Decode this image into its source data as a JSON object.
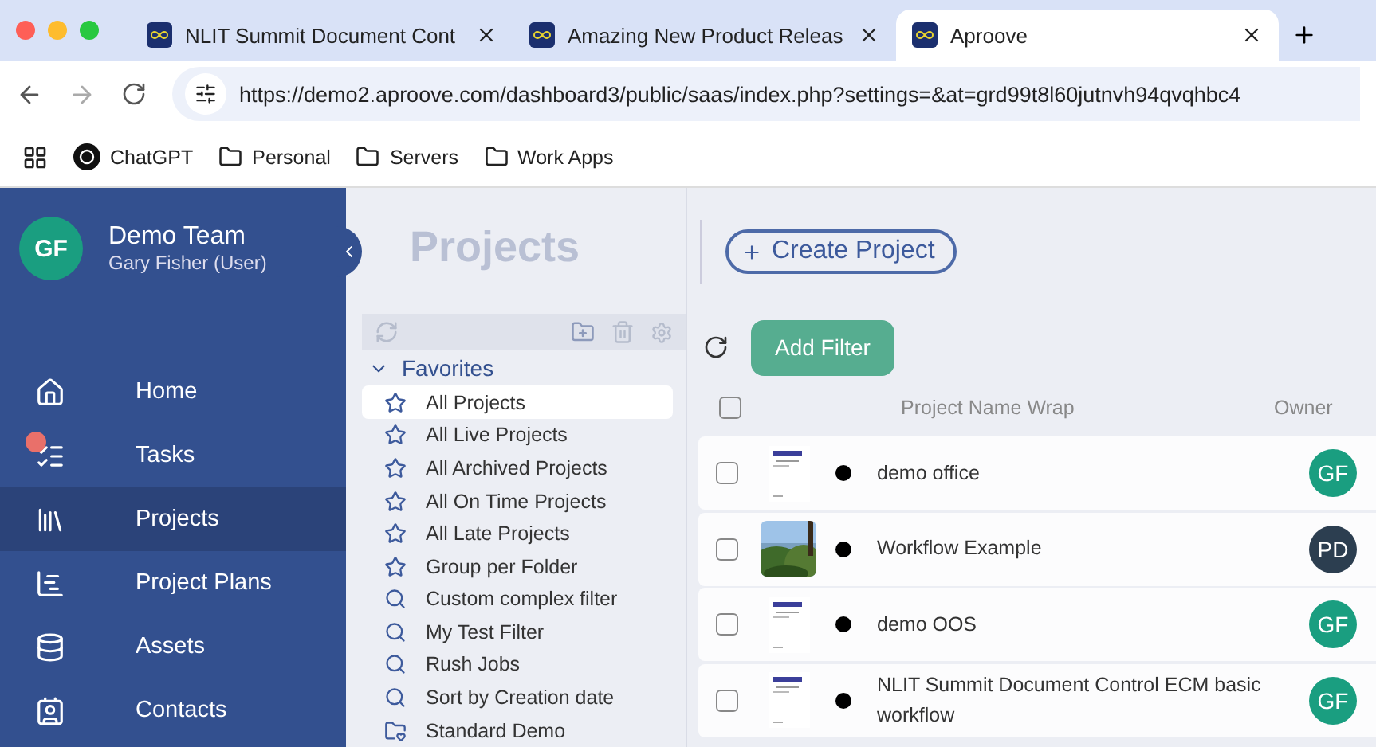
{
  "browser": {
    "tabs": [
      {
        "title": "NLIT Summit Document Cont",
        "selected": false
      },
      {
        "title": "Amazing New Product Releas",
        "selected": false
      },
      {
        "title": "Aproove",
        "selected": true
      }
    ],
    "url": "https://demo2.aproove.com/dashboard3/public/saas/index.php?settings=&at=grd99t8l60jutnvh94qvqhbc4",
    "bookmarks": [
      {
        "kind": "site",
        "label": "ChatGPT"
      },
      {
        "kind": "folder",
        "label": "Personal"
      },
      {
        "kind": "folder",
        "label": "Servers"
      },
      {
        "kind": "folder",
        "label": "Work Apps"
      }
    ]
  },
  "user": {
    "initials": "GF",
    "team": "Demo Team",
    "name": "Gary Fisher (User)"
  },
  "nav": [
    {
      "kind": "home",
      "label": "Home",
      "selected": false,
      "badge": false
    },
    {
      "kind": "tasks",
      "label": "Tasks",
      "selected": false,
      "badge": true
    },
    {
      "kind": "projects",
      "label": "Projects",
      "selected": true,
      "badge": false
    },
    {
      "kind": "plans",
      "label": "Project Plans",
      "selected": false,
      "badge": false
    },
    {
      "kind": "assets",
      "label": "Assets",
      "selected": false,
      "badge": false
    },
    {
      "kind": "contacts",
      "label": "Contacts",
      "selected": false,
      "badge": false
    }
  ],
  "page_title": "Projects",
  "create_button": "Create Project",
  "filters": {
    "group": "Favorites",
    "expanded": true,
    "items": [
      {
        "kind": "star",
        "label": "All Projects",
        "selected": true
      },
      {
        "kind": "star",
        "label": "All Live Projects",
        "selected": false
      },
      {
        "kind": "star",
        "label": "All Archived Projects",
        "selected": false
      },
      {
        "kind": "star",
        "label": "All On Time Projects",
        "selected": false
      },
      {
        "kind": "star",
        "label": "All Late Projects",
        "selected": false
      },
      {
        "kind": "star",
        "label": "Group per Folder",
        "selected": false
      },
      {
        "kind": "search",
        "label": "Custom complex filter",
        "selected": false
      },
      {
        "kind": "search",
        "label": "My Test Filter",
        "selected": false
      },
      {
        "kind": "search",
        "label": "Rush Jobs",
        "selected": false
      },
      {
        "kind": "search",
        "label": "Sort by Creation date",
        "selected": false
      },
      {
        "kind": "folder",
        "label": "Standard Demo",
        "selected": false
      }
    ]
  },
  "add_filter": "Add Filter",
  "table": {
    "columns": [
      "Project Name Wrap",
      "Owner"
    ],
    "all_checked": false,
    "rows": [
      {
        "kind": "document",
        "name": "demo office",
        "owner": "GF",
        "color": "#1a9e80",
        "checked": false
      },
      {
        "kind": "picture",
        "name": "Workflow Example",
        "owner": "PD",
        "color": "#2c3e50",
        "checked": false
      },
      {
        "kind": "document",
        "name": "demo OOS",
        "owner": "GF",
        "color": "#1a9e80",
        "checked": false
      },
      {
        "kind": "document",
        "name": "NLIT Summit Document Control ECM basic workflow",
        "owner": "GF",
        "color": "#1a9e80",
        "checked": false
      }
    ]
  }
}
